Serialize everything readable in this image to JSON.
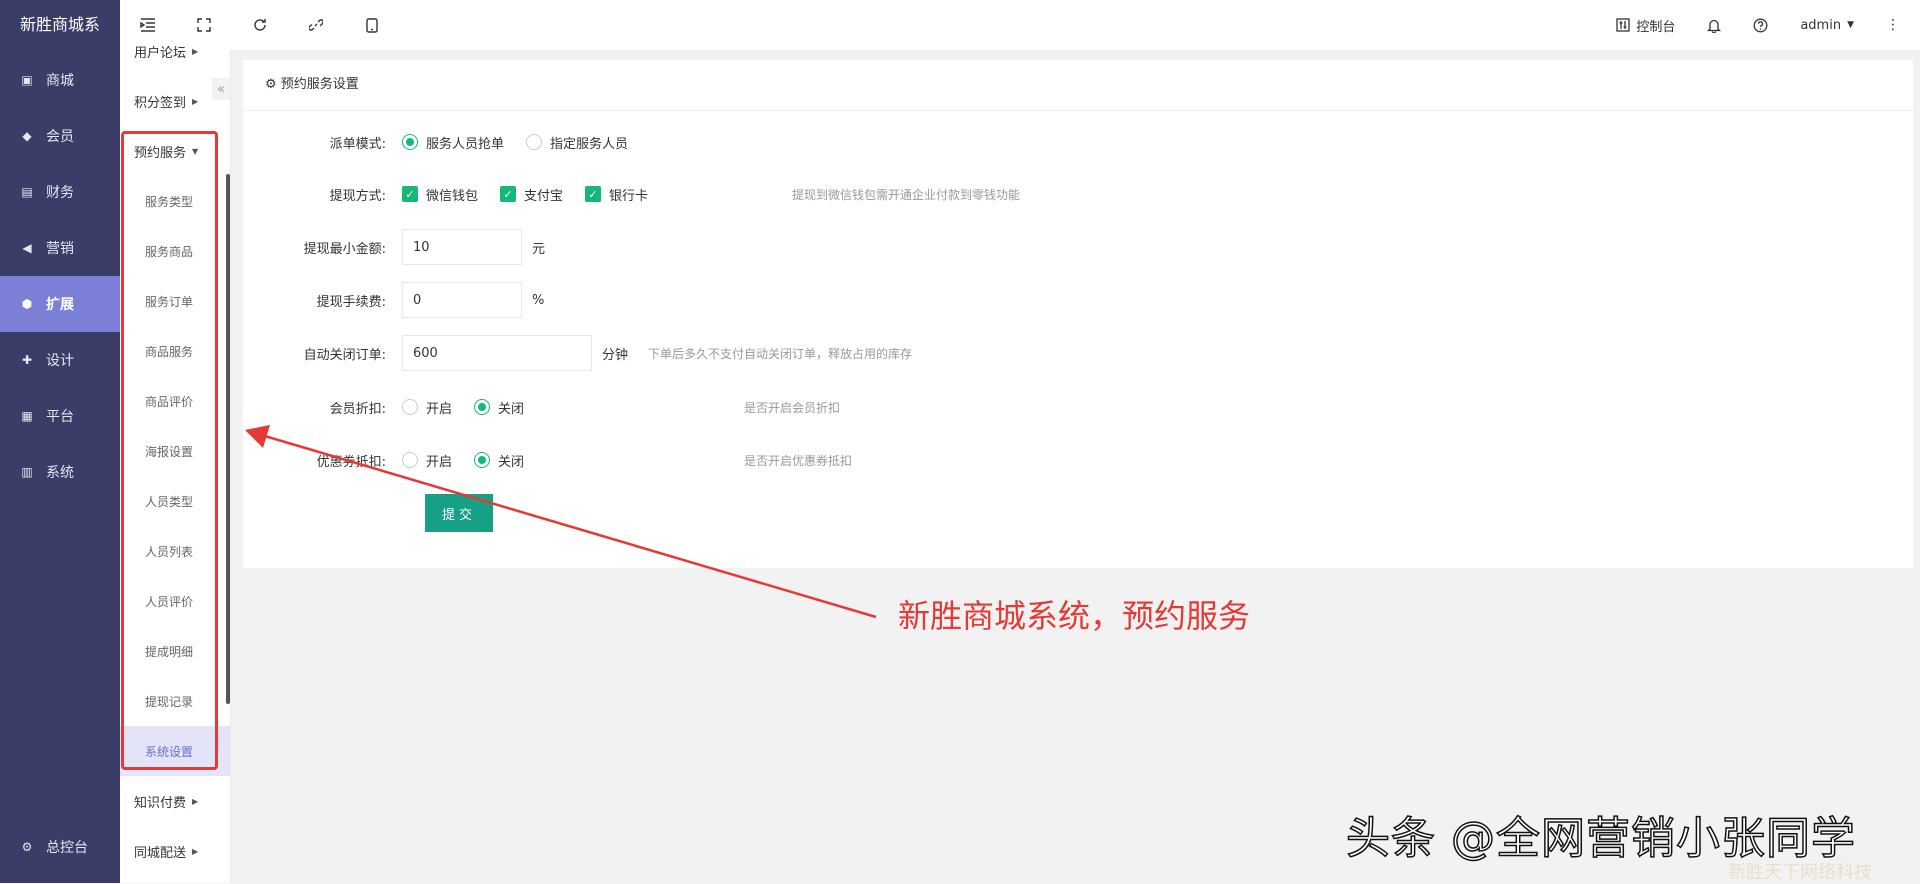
{
  "sidebar": {
    "brand": "新胜商城系",
    "items": [
      {
        "label": "商城",
        "icon": "store-icon"
      },
      {
        "label": "会员",
        "icon": "member-icon"
      },
      {
        "label": "财务",
        "icon": "finance-icon"
      },
      {
        "label": "营销",
        "icon": "megaphone-icon"
      },
      {
        "label": "扩展",
        "icon": "cube-icon"
      },
      {
        "label": "设计",
        "icon": "puzzle-icon"
      },
      {
        "label": "平台",
        "icon": "grid-icon"
      },
      {
        "label": "系统",
        "icon": "monitor-icon"
      }
    ],
    "bottom": {
      "label": "总控台",
      "icon": "gear-icon"
    }
  },
  "subnav": {
    "groups_top": [
      {
        "label": "用户论坛"
      },
      {
        "label": "积分签到"
      },
      {
        "label": "预约服务"
      }
    ],
    "leaves": [
      {
        "label": "服务类型"
      },
      {
        "label": "服务商品"
      },
      {
        "label": "服务订单"
      },
      {
        "label": "商品服务"
      },
      {
        "label": "商品评价"
      },
      {
        "label": "海报设置"
      },
      {
        "label": "人员类型"
      },
      {
        "label": "人员列表"
      },
      {
        "label": "人员评价"
      },
      {
        "label": "提成明细"
      },
      {
        "label": "提现记录"
      },
      {
        "label": "系统设置"
      }
    ],
    "groups_bottom": [
      {
        "label": "知识付费"
      },
      {
        "label": "同城配送"
      }
    ]
  },
  "header": {
    "console": "控制台",
    "user": "admin"
  },
  "card": {
    "title": "预约服务设置",
    "dispatch": {
      "label": "派单模式:",
      "opt1": "服务人员抢单",
      "opt2": "指定服务人员"
    },
    "withdraw": {
      "label": "提现方式:",
      "opt1": "微信钱包",
      "opt2": "支付宝",
      "opt3": "银行卡",
      "tip": "提现到微信钱包需开通企业付款到零钱功能"
    },
    "min_amount": {
      "label": "提现最小金额:",
      "value": "10",
      "unit": "元"
    },
    "fee": {
      "label": "提现手续费:",
      "value": "0",
      "unit": "%"
    },
    "auto_close": {
      "label": "自动关闭订单:",
      "value": "600",
      "unit": "分钟",
      "tip": "下单后多久不支付自动关闭订单，释放占用的库存"
    },
    "member_discount": {
      "label": "会员折扣:",
      "on": "开启",
      "off": "关闭",
      "tip": "是否开启会员折扣"
    },
    "coupon": {
      "label": "优惠券抵扣:",
      "on": "开启",
      "off": "关闭",
      "tip": "是否开启优惠券抵扣"
    },
    "submit": "提交"
  },
  "annotation": "新胜商城系统，预约服务",
  "watermark": "头条 @全网营销小张同学",
  "watermark2": "新胜天下网络科技",
  "colors": {
    "sidebar": "#393d67",
    "active": "#7b7fd6",
    "green": "#16b777",
    "submit": "#16a085",
    "annot": "#e53935"
  }
}
